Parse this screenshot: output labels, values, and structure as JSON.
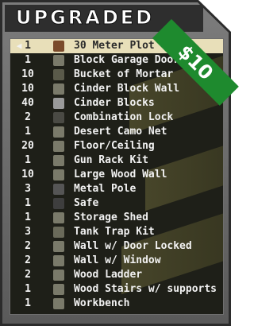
{
  "header": {
    "title": "UPGRADED"
  },
  "badge": {
    "text": "$10",
    "color": "#1e8a2e"
  },
  "list": {
    "selected_index": 0,
    "items": [
      {
        "qty": "1",
        "name": "30 Meter Plot",
        "icon": "brown-box-icon"
      },
      {
        "qty": "1",
        "name": "Block Garage Doorwa",
        "icon": "building-icon"
      },
      {
        "qty": "10",
        "name": "Bucket of Mortar",
        "icon": "bucket-icon"
      },
      {
        "qty": "10",
        "name": "Cinder Block Wall",
        "icon": "building-icon"
      },
      {
        "qty": "40",
        "name": "Cinder Blocks",
        "icon": "blocks-icon"
      },
      {
        "qty": "2",
        "name": "Combination Lock",
        "icon": "lock-icon"
      },
      {
        "qty": "1",
        "name": "Desert Camo Net",
        "icon": "building-icon"
      },
      {
        "qty": "20",
        "name": "Floor/Ceiling",
        "icon": "building-icon"
      },
      {
        "qty": "1",
        "name": "Gun Rack Kit",
        "icon": "building-icon"
      },
      {
        "qty": "10",
        "name": "Large Wood Wall",
        "icon": "building-icon"
      },
      {
        "qty": "3",
        "name": "Metal Pole",
        "icon": "pole-icon"
      },
      {
        "qty": "1",
        "name": "Safe",
        "icon": "safe-icon"
      },
      {
        "qty": "1",
        "name": "Storage Shed",
        "icon": "building-icon"
      },
      {
        "qty": "3",
        "name": "Tank Trap Kit",
        "icon": "trap-icon"
      },
      {
        "qty": "2",
        "name": "Wall w/ Door Locked",
        "icon": "building-icon"
      },
      {
        "qty": "2",
        "name": "Wall w/ Window",
        "icon": "building-icon"
      },
      {
        "qty": "2",
        "name": "Wood Ladder",
        "icon": "building-icon"
      },
      {
        "qty": "1",
        "name": "Wood Stairs w/ supports",
        "icon": "building-icon"
      },
      {
        "qty": "1",
        "name": "Workbench",
        "icon": "building-icon"
      }
    ]
  }
}
